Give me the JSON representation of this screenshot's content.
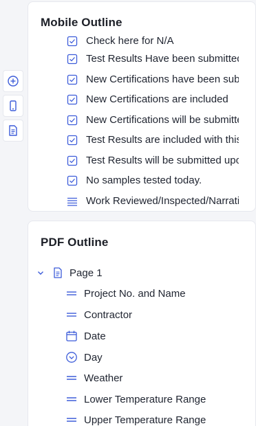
{
  "toolbar": {
    "buttons": [
      {
        "icon": "plus-circle-icon"
      },
      {
        "icon": "mobile-phone-icon"
      },
      {
        "icon": "document-icon"
      }
    ]
  },
  "mobile_outline": {
    "title": "Mobile Outline",
    "items": [
      {
        "label": "Check here for N/A",
        "icon": "checkbox-icon"
      },
      {
        "label": "Test Results Have been submitted",
        "icon": "checkbox-icon"
      },
      {
        "label": "New Certifications have been submitted",
        "icon": "checkbox-icon"
      },
      {
        "label": "New Certifications are included",
        "icon": "checkbox-icon"
      },
      {
        "label": "New Certifications will be submitted",
        "icon": "checkbox-icon"
      },
      {
        "label": "Test Results are included with this report",
        "icon": "checkbox-icon"
      },
      {
        "label": "Test Results will be submitted upon receipt",
        "icon": "checkbox-icon"
      },
      {
        "label": "No samples tested today.",
        "icon": "checkbox-icon"
      },
      {
        "label": "Work Reviewed/Inspected/Narrative",
        "icon": "text-lines-icon"
      }
    ]
  },
  "pdf_outline": {
    "title": "PDF Outline",
    "page": {
      "label": "Page 1"
    },
    "items": [
      {
        "label": "Project No. and Name",
        "icon": "text-field-icon"
      },
      {
        "label": "Contractor",
        "icon": "text-field-icon"
      },
      {
        "label": "Date",
        "icon": "calendar-icon"
      },
      {
        "label": "Day",
        "icon": "dropdown-circle-icon"
      },
      {
        "label": "Weather",
        "icon": "text-field-icon"
      },
      {
        "label": "Lower Temperature Range",
        "icon": "text-field-icon"
      },
      {
        "label": "Upper Temperature Range",
        "icon": "text-field-icon"
      }
    ]
  },
  "colors": {
    "accent": "#3b5bd9",
    "text": "#1f2430",
    "background": "#f4f5f8",
    "panel": "#ffffff"
  }
}
